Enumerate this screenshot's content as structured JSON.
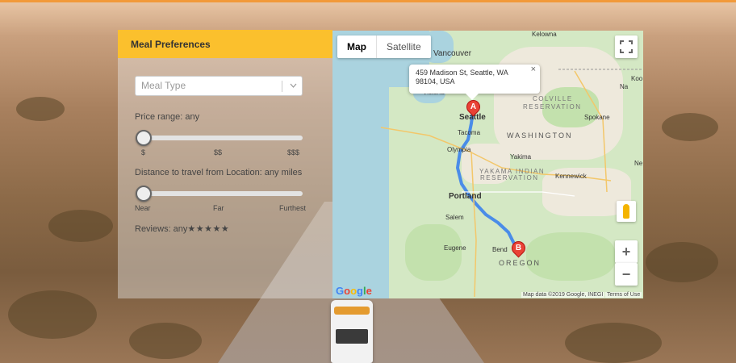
{
  "panel": {
    "title": "Meal Preferences",
    "meal_type_placeholder": "Meal Type",
    "price_label": "Price range: any",
    "price_ticks": [
      "$",
      "$$",
      "$$$"
    ],
    "distance_label": "Distance to travel from Location: any miles",
    "distance_ticks": [
      "Near",
      "Far",
      "Furthest"
    ],
    "reviews_label": "Reviews: any",
    "reviews_stars": "★★★★★"
  },
  "map": {
    "tabs": [
      "Map",
      "Satellite"
    ],
    "info_window": {
      "line1": "459 Madison St, Seattle, WA",
      "line2": "98104, USA"
    },
    "marker_a": "A",
    "marker_b": "B",
    "zoom_in": "+",
    "zoom_out": "−",
    "fullscreen": "⛶",
    "close": "×",
    "cities": {
      "kelowna": "Kelowna",
      "vancouver": "Vancouver",
      "victoria": "Victoria",
      "seattle": "Seattle",
      "tacoma": "Tacoma",
      "olympia": "Olympia",
      "spokane": "Spokane",
      "yakima": "Yakima",
      "kennewick": "Kennewick",
      "portland": "Portland",
      "salem": "Salem",
      "eugene": "Eugene",
      "bend": "Bend",
      "koo": "Koo",
      "na": "Na",
      "ne": "Ne"
    },
    "regions": {
      "colville": "COLVILLE",
      "reservation1": "RESERVATION",
      "yakama": "YAKAMA INDIAN",
      "reservation2": "RESERVATION"
    },
    "states": {
      "washington": "WASHINGTON",
      "oregon": "OREGON"
    },
    "google_logo": "Google",
    "attribution": "Map data ©2019 Google, INEGI",
    "terms": "Terms of Use"
  },
  "colors": {
    "header": "#fbc02d",
    "route": "#4a8ce8",
    "marker": "#e94235"
  }
}
